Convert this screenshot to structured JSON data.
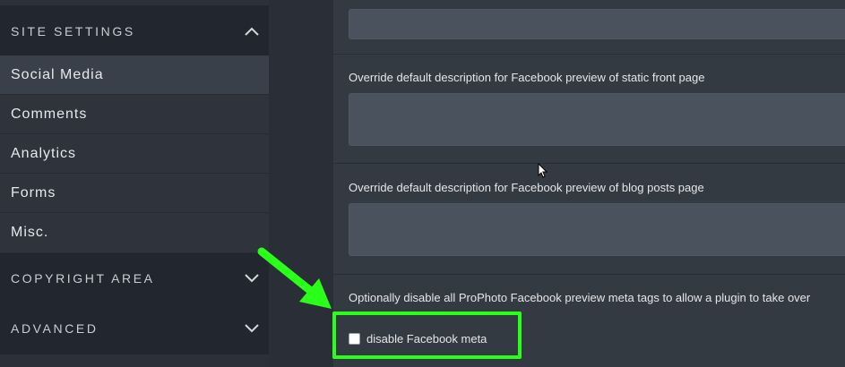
{
  "sidebar": {
    "site_settings": {
      "label": "SITE SETTINGS",
      "icon": "chevron-up-icon"
    },
    "items": [
      {
        "label": "Social Media",
        "active": true
      },
      {
        "label": "Comments",
        "active": false
      },
      {
        "label": "Analytics",
        "active": false
      },
      {
        "label": "Forms",
        "active": false
      },
      {
        "label": "Misc.",
        "active": false
      }
    ],
    "copyright_area": {
      "label": "COPYRIGHT AREA",
      "icon": "chevron-down-icon"
    },
    "advanced": {
      "label": "ADVANCED",
      "icon": "chevron-down-icon"
    }
  },
  "main": {
    "fields": [
      {
        "label": "Override default description for Facebook preview of static front page",
        "value": ""
      },
      {
        "label": "Override default description for Facebook preview of blog posts page",
        "value": ""
      }
    ],
    "meta_section": {
      "label": "Optionally disable all ProPhoto Facebook preview meta tags to allow a plugin to take over",
      "checkbox_label": "disable Facebook meta",
      "checked": false
    }
  },
  "colors": {
    "annotation": "#2aff1a",
    "sidebar_bg": "#2e333c",
    "panel_bg": "#343a42"
  }
}
